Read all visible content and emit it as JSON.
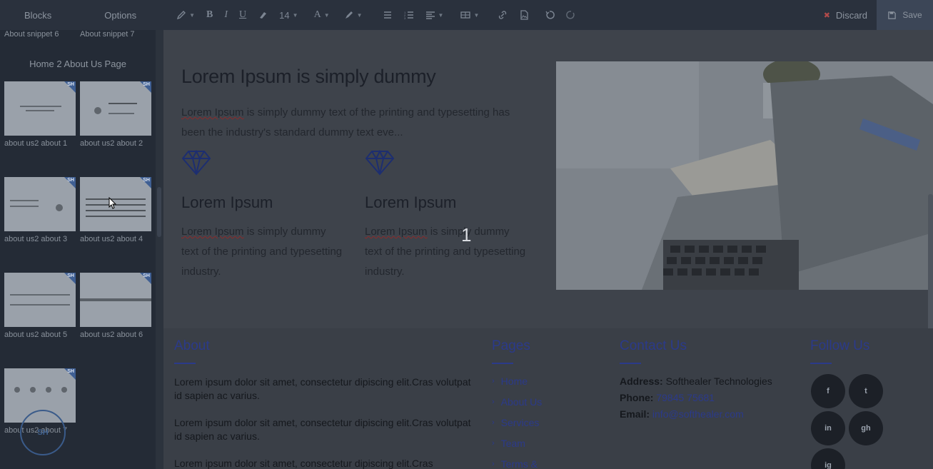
{
  "toolbar": {
    "tabs": [
      "Blocks",
      "Options"
    ],
    "font_size": "14",
    "discard_label": "Discard",
    "save_label": "Save"
  },
  "sidebar": {
    "top_snippets": [
      "About snippet 6",
      "About snippet 7"
    ],
    "section_title": "Home 2 About Us Page",
    "blocks": [
      {
        "label": "about us2 about 1"
      },
      {
        "label": "about us2 about 2"
      },
      {
        "label": "about us2 about 3"
      },
      {
        "label": "about us2 about 4"
      },
      {
        "label": "about us2 about 5"
      },
      {
        "label": "about us2 about 6"
      },
      {
        "label": "about us2 about 7"
      }
    ],
    "badge": "SH"
  },
  "canvas": {
    "hero_title": "Lorem Ipsum is simply dummy",
    "hero_text_a": "Lorem Ipsum",
    "hero_text_b": " is simply dummy text of the printing and typesetting has been the industry's standard dummy text eve...",
    "features": [
      {
        "title": "Lorem Ipsum",
        "text_a": "Lorem Ipsum",
        "text_b": " is simply dummy text of the printing and typesetting industry."
      },
      {
        "title": "Lorem Ipsum",
        "text_a": "Lorem Ipsum",
        "text_b": " is simply dummy text of the printing and typesetting industry."
      }
    ],
    "overlay_number": "1"
  },
  "footer": {
    "about": {
      "heading": "About",
      "paragraphs": [
        "Lorem ipsum dolor sit amet, consectetur dipiscing elit.Cras volutpat id sapien ac varius.",
        "Lorem ipsum dolor sit amet, consectetur dipiscing elit.Cras volutpat id sapien ac varius.",
        "Lorem ipsum dolor sit amet, consectetur dipiscing elit.Cras"
      ]
    },
    "pages": {
      "heading": "Pages",
      "links": [
        "Home",
        "About Us",
        "Services",
        "Team",
        "Terms &"
      ]
    },
    "contact": {
      "heading": "Contact Us",
      "address_label": "Address:",
      "address_value": "Softhealer Technologies",
      "phone_label": "Phone:",
      "phone_value": "79845 75681",
      "email_label": "Email:",
      "email_value": "info@softhealer.com"
    },
    "follow": {
      "heading": "Follow Us",
      "icons": [
        "f",
        "t",
        "in",
        "gh",
        "ig"
      ]
    }
  },
  "colors": {
    "accent_blue": "#2b3a8a",
    "toolbar_bg": "#2a313d",
    "sidebar_bg": "#242b36",
    "canvas_overlay": "#3e434b"
  }
}
